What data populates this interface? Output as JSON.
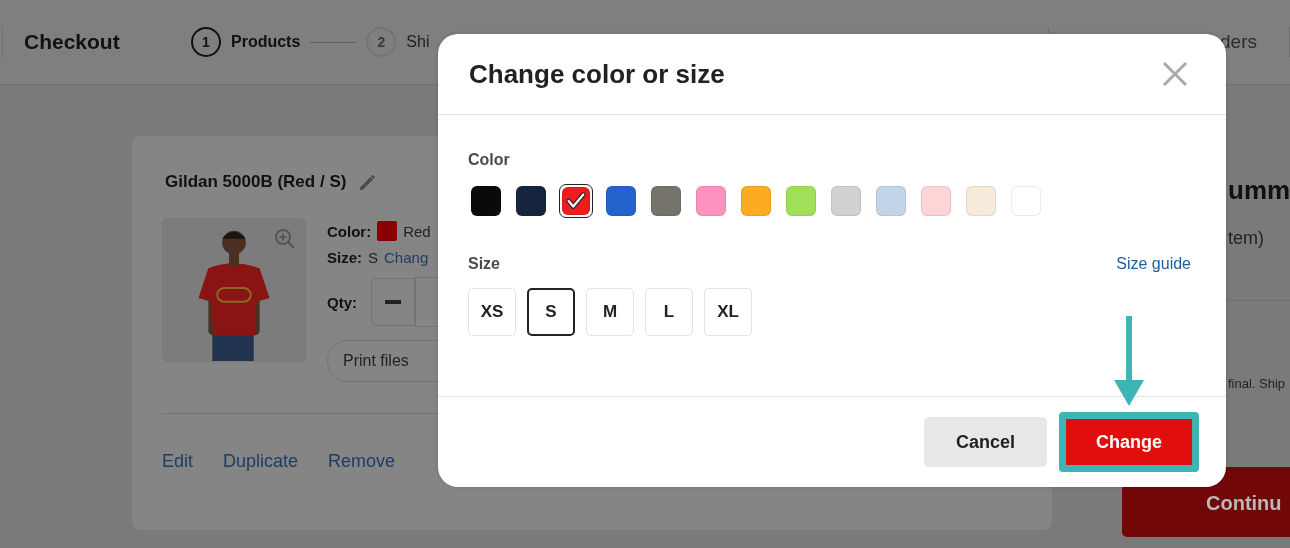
{
  "header": {
    "title": "Checkout",
    "steps": [
      {
        "number": "1",
        "label": "Products",
        "selected": true
      },
      {
        "number": "2",
        "label": "Shi",
        "selected": false
      }
    ],
    "orders_link": "ders"
  },
  "product": {
    "title": "Gildan 5000B (Red / S)",
    "color_label": "Color:",
    "color_value": "Red",
    "size_label": "Size:",
    "size_value": "S",
    "change_link": "Chang",
    "qty_label": "Qty:",
    "print_files": "Print files",
    "actions": [
      "Edit",
      "Duplicate",
      "Remove"
    ]
  },
  "summary": {
    "title": "umm",
    "items_note": "tem)",
    "note": "final. Ship",
    "continue": "Continu"
  },
  "modal": {
    "title": "Change color or size",
    "color_label": "Color",
    "colors": [
      {
        "color": "#0a0a0a",
        "selected": false
      },
      {
        "color": "#17243f",
        "selected": false
      },
      {
        "color": "#ee1c1c",
        "selected": true
      },
      {
        "color": "#2563cc",
        "selected": false
      },
      {
        "color": "#76736b",
        "selected": false
      },
      {
        "color": "#fc92bd",
        "selected": false
      },
      {
        "color": "#fdab22",
        "selected": false
      },
      {
        "color": "#a0df58",
        "selected": false
      },
      {
        "color": "#d1d1d1",
        "selected": false
      },
      {
        "color": "#c2d5e8",
        "selected": false
      },
      {
        "color": "#fdd5d6",
        "selected": false
      },
      {
        "color": "#f6eadb",
        "selected": false
      },
      {
        "color": "#ffffff",
        "selected": false
      }
    ],
    "size_label": "Size",
    "size_guide": "Size guide",
    "sizes": [
      {
        "label": "XS",
        "selected": false
      },
      {
        "label": "S",
        "selected": true
      },
      {
        "label": "M",
        "selected": false
      },
      {
        "label": "L",
        "selected": false
      },
      {
        "label": "XL",
        "selected": false
      }
    ],
    "buttons": [
      {
        "label": "Cancel",
        "kind": "secondary",
        "highlighted": false
      },
      {
        "label": "Change",
        "kind": "primary",
        "highlighted": true
      }
    ]
  }
}
